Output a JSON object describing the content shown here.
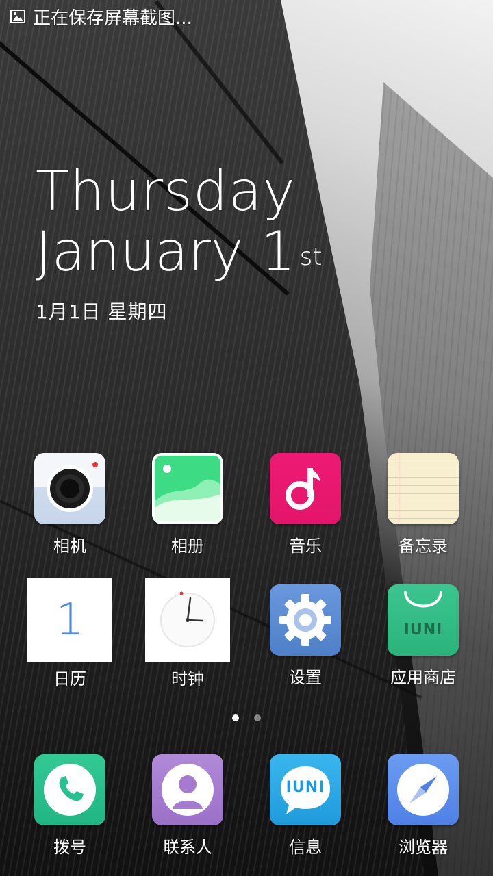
{
  "status_bar": {
    "icon": "image-icon",
    "text": "正在保存屏幕截图..."
  },
  "date_widget": {
    "weekday": "Thursday",
    "month_day": "January 1",
    "ordinal": "st",
    "chinese_date": "1月1日  星期四"
  },
  "apps": [
    {
      "label": "相机",
      "icon": "camera-icon"
    },
    {
      "label": "相册",
      "icon": "gallery-icon"
    },
    {
      "label": "音乐",
      "icon": "music-note-icon"
    },
    {
      "label": "备忘录",
      "icon": "notepad-icon"
    },
    {
      "label": "日历",
      "icon": "calendar-icon",
      "day": "1"
    },
    {
      "label": "时钟",
      "icon": "clock-icon"
    },
    {
      "label": "设置",
      "icon": "gear-icon"
    },
    {
      "label": "应用商店",
      "icon": "shopping-bag-icon",
      "brand": "IUNI"
    }
  ],
  "page_indicator": {
    "current": 1,
    "total": 2
  },
  "dock": [
    {
      "label": "拨号",
      "icon": "phone-icon"
    },
    {
      "label": "联系人",
      "icon": "contact-icon"
    },
    {
      "label": "信息",
      "icon": "message-bubble-icon",
      "brand": "IUNI"
    },
    {
      "label": "浏览器",
      "icon": "compass-icon"
    }
  ],
  "colors": {
    "music": "#e8176f",
    "store": "#2fbf86",
    "dialer": "#27c08f",
    "contacts": "#a57bd0",
    "messages": "#2aa9e6",
    "browser": "#5b8def",
    "settings": "#5c8dd6"
  }
}
